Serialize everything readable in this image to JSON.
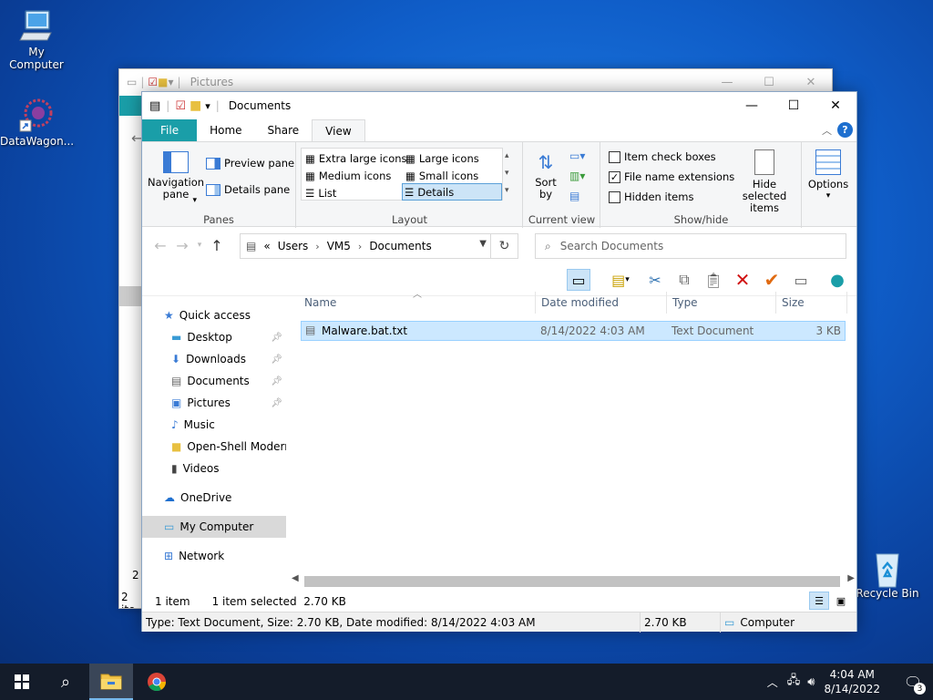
{
  "desktop": {
    "icons": [
      {
        "label": "My Computer"
      },
      {
        "label": "DataWagon..."
      },
      {
        "label": "Recycle Bin"
      }
    ]
  },
  "back_window": {
    "title": "Pictures",
    "status_partial_1": "2",
    "status_partial_2": "2 ite"
  },
  "window": {
    "title": "Documents",
    "tabs": [
      {
        "label": "File"
      },
      {
        "label": "Home"
      },
      {
        "label": "Share"
      },
      {
        "label": "View"
      }
    ],
    "ribbon": {
      "panes": {
        "navigation_pane": "Navigation\npane",
        "preview_pane": "Preview pane",
        "details_pane": "Details pane",
        "group_label": "Panes"
      },
      "layout": {
        "items": [
          "Extra large icons",
          "Large icons",
          "Medium icons",
          "Small icons",
          "List",
          "Details"
        ],
        "selected": "Details",
        "group_label": "Layout"
      },
      "current_view": {
        "sort_by": "Sort\nby",
        "group_label": "Current view"
      },
      "show_hide": {
        "item_check_boxes": "Item check boxes",
        "item_check_boxes_checked": false,
        "file_name_extensions": "File name extensions",
        "file_name_extensions_checked": true,
        "hidden_items": "Hidden items",
        "hidden_items_checked": false,
        "hide_selected_items": "Hide selected\nitems",
        "group_label": "Show/hide"
      },
      "options": "Options"
    },
    "address": {
      "prefix": "«",
      "crumbs": [
        "Users",
        "VM5",
        "Documents"
      ]
    },
    "search": {
      "placeholder": "Search Documents"
    },
    "nav_pane": {
      "items": [
        {
          "label": "Quick access",
          "icon": "star-icon",
          "pinned": false
        },
        {
          "label": "Desktop",
          "icon": "desktop-folder-icon",
          "pinned": true
        },
        {
          "label": "Downloads",
          "icon": "download-icon",
          "pinned": true
        },
        {
          "label": "Documents",
          "icon": "documents-icon",
          "pinned": true
        },
        {
          "label": "Pictures",
          "icon": "pictures-icon",
          "pinned": true
        },
        {
          "label": "Music",
          "icon": "music-icon",
          "pinned": false
        },
        {
          "label": "Open-Shell Modern",
          "icon": "folder-icon",
          "pinned": false
        },
        {
          "label": "Videos",
          "icon": "videos-icon",
          "pinned": false
        },
        {
          "label": "OneDrive",
          "icon": "cloud-icon",
          "pinned": false
        },
        {
          "label": "My Computer",
          "icon": "computer-icon",
          "pinned": false
        },
        {
          "label": "Network",
          "icon": "network-icon",
          "pinned": false
        }
      ],
      "selected": "My Computer"
    },
    "file_list": {
      "columns": [
        "Name",
        "Date modified",
        "Type",
        "Size"
      ],
      "rows": [
        {
          "name": "Malware.bat.txt",
          "date": "8/14/2022 4:03 AM",
          "type": "Text Document",
          "size": "3 KB"
        }
      ]
    },
    "status": {
      "count": "1 item",
      "selection": "1 item selected  2.70 KB"
    },
    "details_bar": {
      "info": "Type: Text Document, Size: 2.70 KB, Date modified: 8/14/2022 4:03 AM",
      "size": "2.70 KB",
      "location": "Computer"
    }
  },
  "taskbar": {
    "time": "4:04 AM",
    "date": "8/14/2022",
    "notifications": "3"
  },
  "colors": {
    "file_tab": "#1a9ea8",
    "selection": "#cce8ff",
    "taskbar": "#141c2a"
  }
}
